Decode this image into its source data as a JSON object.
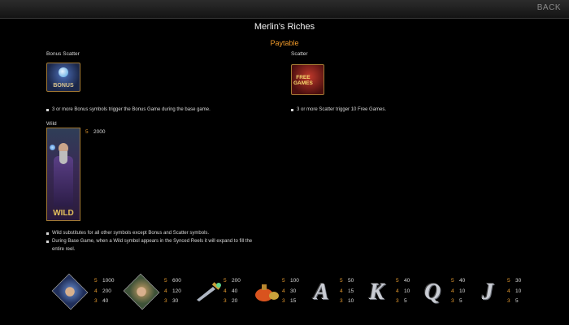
{
  "header": {
    "back_label": "BACK"
  },
  "title": "Merlin's Riches",
  "subtitle": "Paytable",
  "bonus_scatter": {
    "label": "Bonus Scatter",
    "symbol_text": "BONUS",
    "desc": "3 or more Bonus symbols trigger the Bonus Game during the base game."
  },
  "scatter": {
    "label": "Scatter",
    "symbol_text_1": "FREE",
    "symbol_text_2": "GAMES",
    "desc": "3 or more Scatter trigger 10 Free Games."
  },
  "wild": {
    "label": "Wild",
    "symbol_text": "WILD",
    "pay_count": "5",
    "pay_value": "2000",
    "desc_1": "Wild substitutes for all other symbols except Bonus and Scatter symbols.",
    "desc_2": "During Base Game, when a Wild symbol appears in the Synced Reels it will expand to fill the",
    "desc_3": "entire reel."
  },
  "symbols": [
    {
      "icon": "king-icon",
      "pays": [
        [
          "5",
          "1000"
        ],
        [
          "4",
          "200"
        ],
        [
          "3",
          "40"
        ]
      ]
    },
    {
      "icon": "queen-icon",
      "pays": [
        [
          "5",
          "600"
        ],
        [
          "4",
          "120"
        ],
        [
          "3",
          "30"
        ]
      ]
    },
    {
      "icon": "sword-icon",
      "pays": [
        [
          "5",
          "200"
        ],
        [
          "4",
          "40"
        ],
        [
          "3",
          "20"
        ]
      ]
    },
    {
      "icon": "potion-icon",
      "pays": [
        [
          "5",
          "100"
        ],
        [
          "4",
          "30"
        ],
        [
          "3",
          "15"
        ]
      ]
    },
    {
      "icon": "letter-a-icon",
      "glyph": "A",
      "pays": [
        [
          "5",
          "50"
        ],
        [
          "4",
          "15"
        ],
        [
          "3",
          "10"
        ]
      ]
    },
    {
      "icon": "letter-k-icon",
      "glyph": "K",
      "pays": [
        [
          "5",
          "40"
        ],
        [
          "4",
          "10"
        ],
        [
          "3",
          "5"
        ]
      ]
    },
    {
      "icon": "letter-q-icon",
      "glyph": "Q",
      "pays": [
        [
          "5",
          "40"
        ],
        [
          "4",
          "10"
        ],
        [
          "3",
          "5"
        ]
      ]
    },
    {
      "icon": "letter-j-icon",
      "glyph": "J",
      "pays": [
        [
          "5",
          "30"
        ],
        [
          "4",
          "10"
        ],
        [
          "3",
          "5"
        ]
      ]
    }
  ],
  "colors": {
    "accent": "#f09a2a",
    "background": "#000000"
  }
}
